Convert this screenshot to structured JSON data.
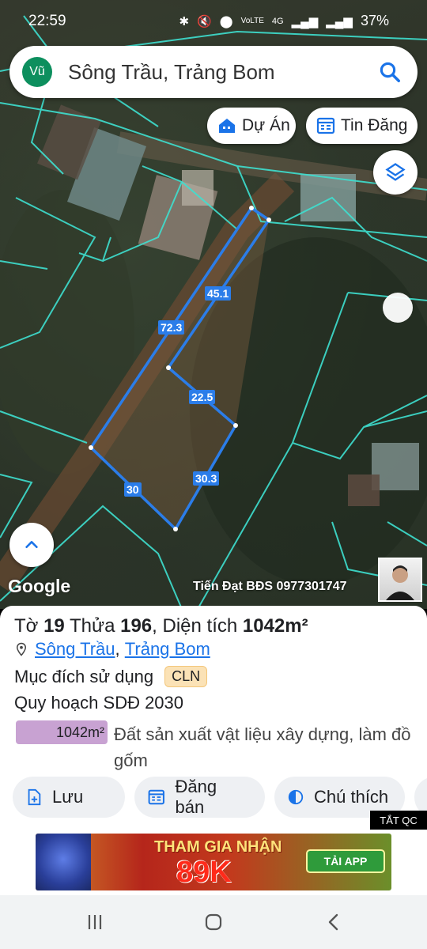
{
  "status_bar": {
    "time": "22:59",
    "icons": [
      "bluetooth-icon",
      "mute-icon",
      "location-icon",
      "volte-icon",
      "4g-icon",
      "signal-icon",
      "signal-icon"
    ],
    "battery": "37%"
  },
  "search": {
    "avatar_initials": "Vũ",
    "query": "Sông Trầu, Trảng Bom"
  },
  "map_buttons": {
    "du_an": "Dự Án",
    "tin_dang": "Tin Đăng"
  },
  "map": {
    "provider": "Google",
    "watermark": "Tiến Đạt BĐS 0977301747",
    "dimensions": [
      "45.1",
      "72.3",
      "22.5",
      "30.3",
      "30"
    ]
  },
  "parcel": {
    "to_label": "Tờ ",
    "to_value": "19",
    "thua_label": " Thửa ",
    "thua_value": "196",
    "area_label": ", Diện tích ",
    "area_value": "1042m²",
    "commune": "Sông Trầu",
    "separator": ",",
    "district": "Trảng Bom",
    "purpose_label": "Mục đích sử dụng",
    "purpose_code": "CLN",
    "planning_label": "Quy hoạch SDĐ 2030",
    "planning_area": "1042m²",
    "planning_desc": "Đất sản xuất vật liệu xây dựng, làm đồ gốm",
    "planning_color": "#c8a2d2"
  },
  "actions": {
    "save": "Lưu",
    "sell": "Đăng bán",
    "legend": "Chú thích"
  },
  "ad": {
    "close_label": "TẮT QC",
    "line1": "THAM GIA NHẬN",
    "line2": "89K",
    "cta": "TẢI APP"
  },
  "colors": {
    "accent": "#1a73e8",
    "parcel_line": "#2b7de9",
    "cadastral_line": "#3ee0d0"
  }
}
